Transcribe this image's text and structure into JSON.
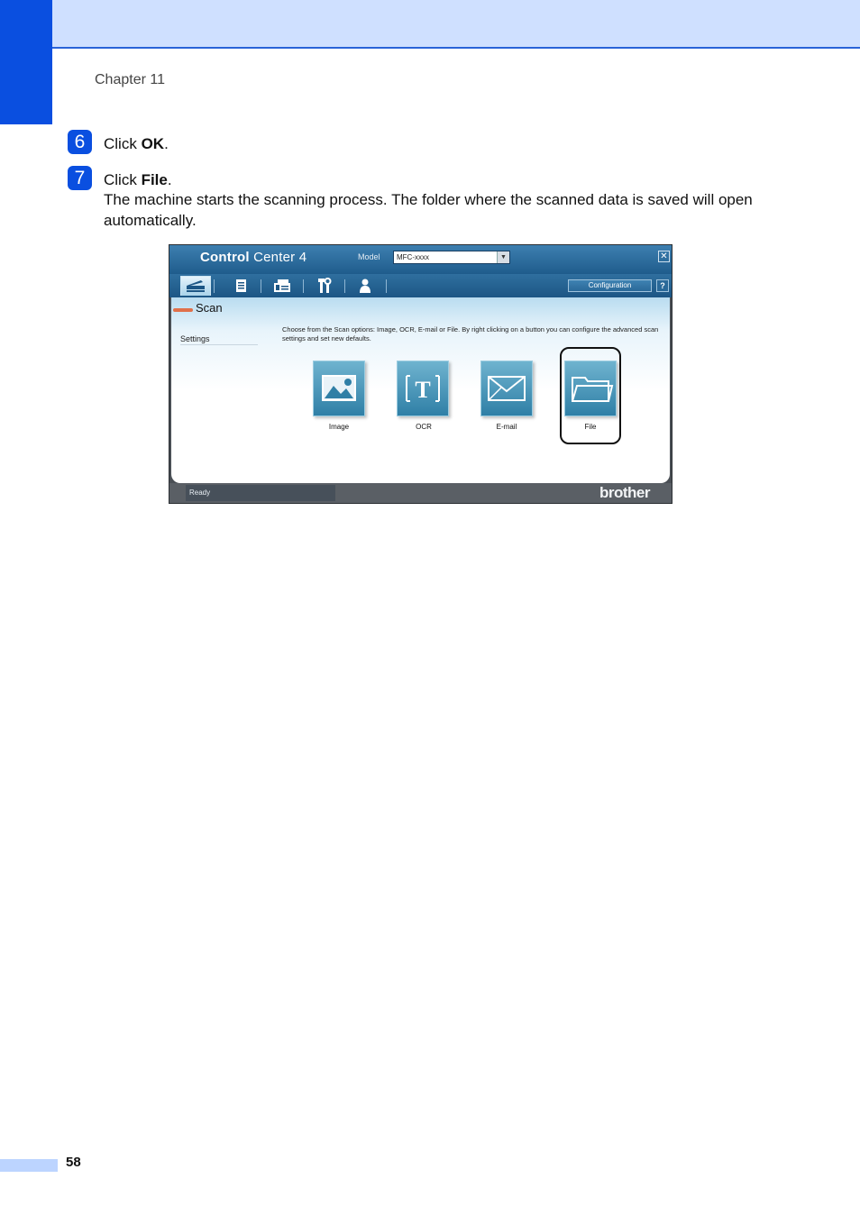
{
  "header": {
    "chapter": "Chapter 11"
  },
  "steps": [
    {
      "number": "6",
      "prefix": "Click ",
      "bold": "OK",
      "suffix": "."
    },
    {
      "number": "7",
      "prefix": "Click ",
      "bold": "File",
      "suffix": ".",
      "description": "The machine starts the scanning process. The folder where the scanned data is saved will open automatically."
    }
  ],
  "screenshot": {
    "logo_bold": "Control",
    "logo_rest": " Center 4",
    "model_label": "Model",
    "model_value": "MFC-xxxx",
    "configuration_label": "Configuration",
    "help_label": "?",
    "section_title": "Scan",
    "settings_label": "Settings",
    "description": "Choose from the Scan options: Image, OCR, E-mail or File. By right clicking on a button you can configure the advanced scan settings and set new defaults.",
    "buttons": [
      {
        "label": "Image",
        "icon": "image-icon"
      },
      {
        "label": "OCR",
        "icon": "ocr-icon"
      },
      {
        "label": "E-mail",
        "icon": "email-icon"
      },
      {
        "label": "File",
        "icon": "folder-icon"
      }
    ],
    "status": "Ready",
    "brand": "brother",
    "colors": {
      "accent": "#0a4fe0",
      "title_bar": "#1f5c8c",
      "highlight": "#111111"
    }
  },
  "footer": {
    "page_number": "58"
  }
}
